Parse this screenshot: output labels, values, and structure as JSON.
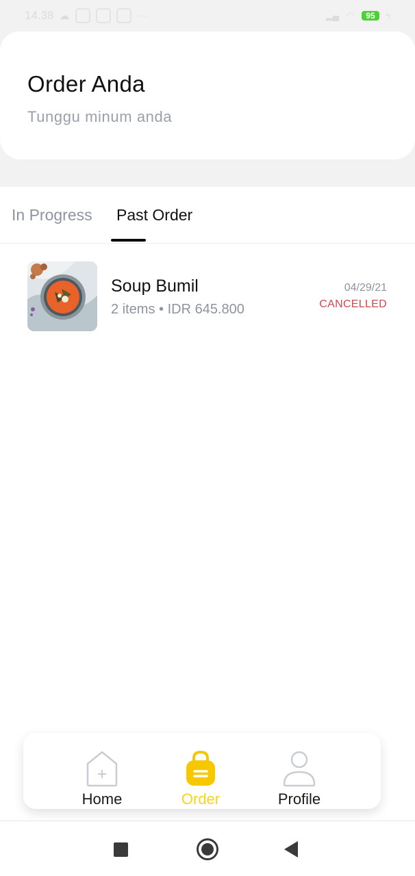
{
  "status_bar": {
    "time": "14.38",
    "signal_dots": "···",
    "battery": "95"
  },
  "header": {
    "title": "Order Anda",
    "subtitle": "Tunggu minum anda"
  },
  "tabs": [
    {
      "label": "In Progress",
      "active": false
    },
    {
      "label": "Past Order",
      "active": true
    }
  ],
  "orders": [
    {
      "name": "Soup Bumil",
      "meta": "2 items • IDR 645.800",
      "date": "04/29/21",
      "status": "CANCELLED",
      "image_icon": "soup-bowl-image"
    }
  ],
  "bottom_nav": {
    "home": "Home",
    "order": "Order",
    "profile": "Profile",
    "active": "order"
  },
  "colors": {
    "accent": "#f7d51d",
    "cancelled": "#d0464f",
    "muted_text": "#8d94a0",
    "battery": "#4cd137"
  }
}
